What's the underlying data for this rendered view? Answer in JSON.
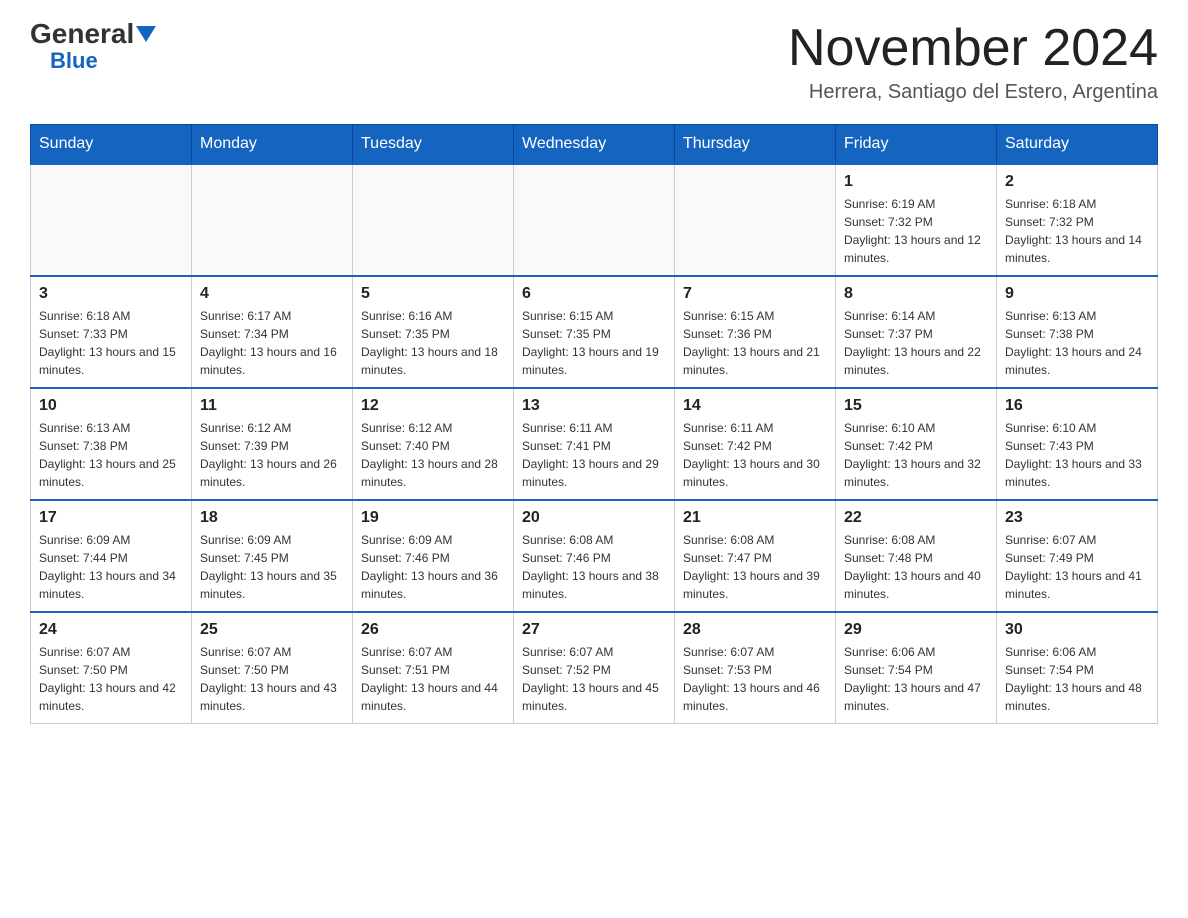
{
  "header": {
    "logo_general": "General",
    "logo_blue": "Blue",
    "main_title": "November 2024",
    "subtitle": "Herrera, Santiago del Estero, Argentina"
  },
  "days_of_week": [
    "Sunday",
    "Monday",
    "Tuesday",
    "Wednesday",
    "Thursday",
    "Friday",
    "Saturday"
  ],
  "weeks": [
    [
      {
        "day": "",
        "info": ""
      },
      {
        "day": "",
        "info": ""
      },
      {
        "day": "",
        "info": ""
      },
      {
        "day": "",
        "info": ""
      },
      {
        "day": "",
        "info": ""
      },
      {
        "day": "1",
        "info": "Sunrise: 6:19 AM\nSunset: 7:32 PM\nDaylight: 13 hours and 12 minutes."
      },
      {
        "day": "2",
        "info": "Sunrise: 6:18 AM\nSunset: 7:32 PM\nDaylight: 13 hours and 14 minutes."
      }
    ],
    [
      {
        "day": "3",
        "info": "Sunrise: 6:18 AM\nSunset: 7:33 PM\nDaylight: 13 hours and 15 minutes."
      },
      {
        "day": "4",
        "info": "Sunrise: 6:17 AM\nSunset: 7:34 PM\nDaylight: 13 hours and 16 minutes."
      },
      {
        "day": "5",
        "info": "Sunrise: 6:16 AM\nSunset: 7:35 PM\nDaylight: 13 hours and 18 minutes."
      },
      {
        "day": "6",
        "info": "Sunrise: 6:15 AM\nSunset: 7:35 PM\nDaylight: 13 hours and 19 minutes."
      },
      {
        "day": "7",
        "info": "Sunrise: 6:15 AM\nSunset: 7:36 PM\nDaylight: 13 hours and 21 minutes."
      },
      {
        "day": "8",
        "info": "Sunrise: 6:14 AM\nSunset: 7:37 PM\nDaylight: 13 hours and 22 minutes."
      },
      {
        "day": "9",
        "info": "Sunrise: 6:13 AM\nSunset: 7:38 PM\nDaylight: 13 hours and 24 minutes."
      }
    ],
    [
      {
        "day": "10",
        "info": "Sunrise: 6:13 AM\nSunset: 7:38 PM\nDaylight: 13 hours and 25 minutes."
      },
      {
        "day": "11",
        "info": "Sunrise: 6:12 AM\nSunset: 7:39 PM\nDaylight: 13 hours and 26 minutes."
      },
      {
        "day": "12",
        "info": "Sunrise: 6:12 AM\nSunset: 7:40 PM\nDaylight: 13 hours and 28 minutes."
      },
      {
        "day": "13",
        "info": "Sunrise: 6:11 AM\nSunset: 7:41 PM\nDaylight: 13 hours and 29 minutes."
      },
      {
        "day": "14",
        "info": "Sunrise: 6:11 AM\nSunset: 7:42 PM\nDaylight: 13 hours and 30 minutes."
      },
      {
        "day": "15",
        "info": "Sunrise: 6:10 AM\nSunset: 7:42 PM\nDaylight: 13 hours and 32 minutes."
      },
      {
        "day": "16",
        "info": "Sunrise: 6:10 AM\nSunset: 7:43 PM\nDaylight: 13 hours and 33 minutes."
      }
    ],
    [
      {
        "day": "17",
        "info": "Sunrise: 6:09 AM\nSunset: 7:44 PM\nDaylight: 13 hours and 34 minutes."
      },
      {
        "day": "18",
        "info": "Sunrise: 6:09 AM\nSunset: 7:45 PM\nDaylight: 13 hours and 35 minutes."
      },
      {
        "day": "19",
        "info": "Sunrise: 6:09 AM\nSunset: 7:46 PM\nDaylight: 13 hours and 36 minutes."
      },
      {
        "day": "20",
        "info": "Sunrise: 6:08 AM\nSunset: 7:46 PM\nDaylight: 13 hours and 38 minutes."
      },
      {
        "day": "21",
        "info": "Sunrise: 6:08 AM\nSunset: 7:47 PM\nDaylight: 13 hours and 39 minutes."
      },
      {
        "day": "22",
        "info": "Sunrise: 6:08 AM\nSunset: 7:48 PM\nDaylight: 13 hours and 40 minutes."
      },
      {
        "day": "23",
        "info": "Sunrise: 6:07 AM\nSunset: 7:49 PM\nDaylight: 13 hours and 41 minutes."
      }
    ],
    [
      {
        "day": "24",
        "info": "Sunrise: 6:07 AM\nSunset: 7:50 PM\nDaylight: 13 hours and 42 minutes."
      },
      {
        "day": "25",
        "info": "Sunrise: 6:07 AM\nSunset: 7:50 PM\nDaylight: 13 hours and 43 minutes."
      },
      {
        "day": "26",
        "info": "Sunrise: 6:07 AM\nSunset: 7:51 PM\nDaylight: 13 hours and 44 minutes."
      },
      {
        "day": "27",
        "info": "Sunrise: 6:07 AM\nSunset: 7:52 PM\nDaylight: 13 hours and 45 minutes."
      },
      {
        "day": "28",
        "info": "Sunrise: 6:07 AM\nSunset: 7:53 PM\nDaylight: 13 hours and 46 minutes."
      },
      {
        "day": "29",
        "info": "Sunrise: 6:06 AM\nSunset: 7:54 PM\nDaylight: 13 hours and 47 minutes."
      },
      {
        "day": "30",
        "info": "Sunrise: 6:06 AM\nSunset: 7:54 PM\nDaylight: 13 hours and 48 minutes."
      }
    ]
  ]
}
